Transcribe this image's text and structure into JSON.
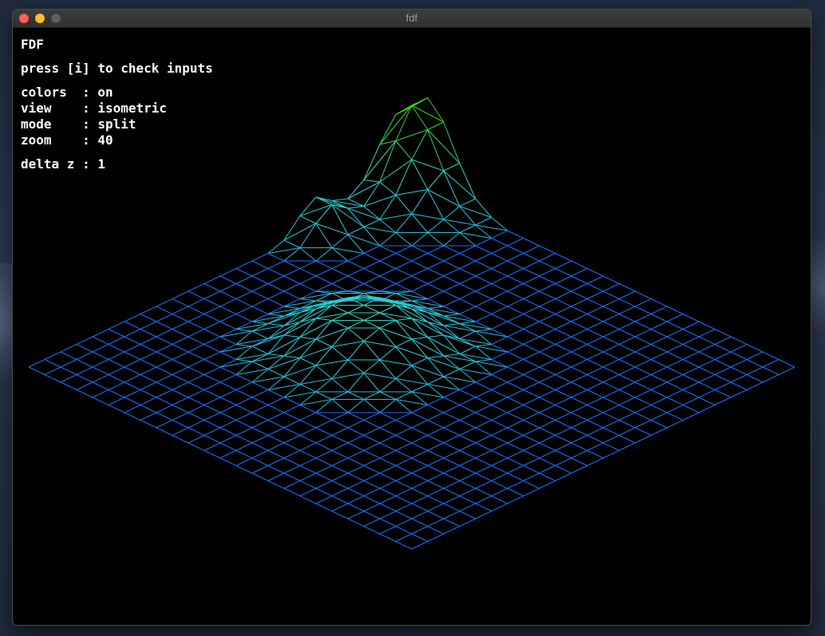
{
  "window": {
    "title": "fdf"
  },
  "hud": {
    "program_name": "FDF",
    "hint": "press [i] to check inputs",
    "settings": [
      {
        "label": "colors  : on"
      },
      {
        "label": "view    : isometric"
      },
      {
        "label": "mode    : split"
      },
      {
        "label": "zoom    : 40"
      }
    ],
    "delta_z": "delta z : 1"
  },
  "colors": {
    "low": "#1e6fff",
    "mid": "#2ad8d0",
    "high": "#3cd11e",
    "background": "#000000"
  }
}
